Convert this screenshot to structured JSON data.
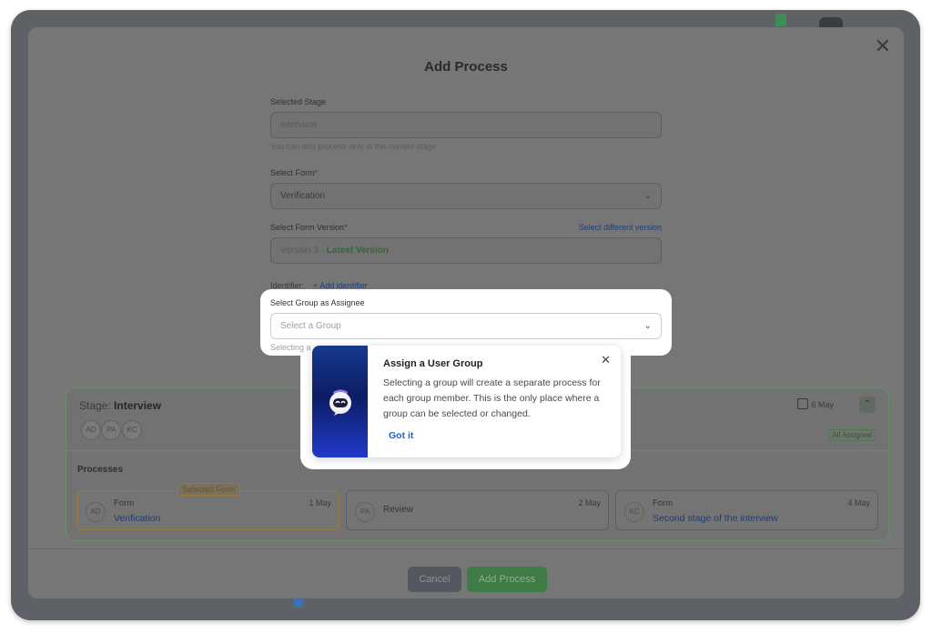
{
  "modal": {
    "title": "Add Process",
    "selected_stage_label": "Selected Stage",
    "selected_stage_value": "Interview",
    "selected_stage_hint": "You can add process only in the current stage",
    "select_form_label": "Select Form",
    "select_form_value": "Verification",
    "form_version_label": "Select Form Version",
    "select_different_version": "Select different version",
    "form_version_prefix": "Version 3 · ",
    "form_version_latest": "Latest Version",
    "identifier_label": "Identifier:",
    "add_identifier": "+  Add identifier",
    "group_label": "Select Group as Assignee",
    "group_placeholder": "Select a Group",
    "group_hint": "Selecting a"
  },
  "popover": {
    "title": "Assign a User Group",
    "body": "Selecting a group will create a separate process for each group member. This is the only place where a group can be selected or changed.",
    "action": "Got it"
  },
  "stage": {
    "prefix": "Stage:",
    "name": "Interview",
    "avatars": [
      "AD",
      "PA",
      "KC"
    ],
    "date": "6 May",
    "status": "All Assigned",
    "processes_label": "Processes",
    "processes": [
      {
        "initials": "AD",
        "type": "Form",
        "name": "Verification",
        "date": "1 May",
        "tag": "Selected Form"
      },
      {
        "initials": "PA",
        "type": "",
        "name": "Review",
        "date": "2 May"
      },
      {
        "initials": "KC",
        "type": "Form",
        "name": "Second stage of the interview",
        "date": "4 May"
      }
    ]
  },
  "buttons": {
    "cancel": "Cancel",
    "add": "Add Process"
  },
  "colors": {
    "accent_link": "#1e63c2",
    "primary_button": "#4caf50",
    "latest_version": "#2e7d32"
  }
}
